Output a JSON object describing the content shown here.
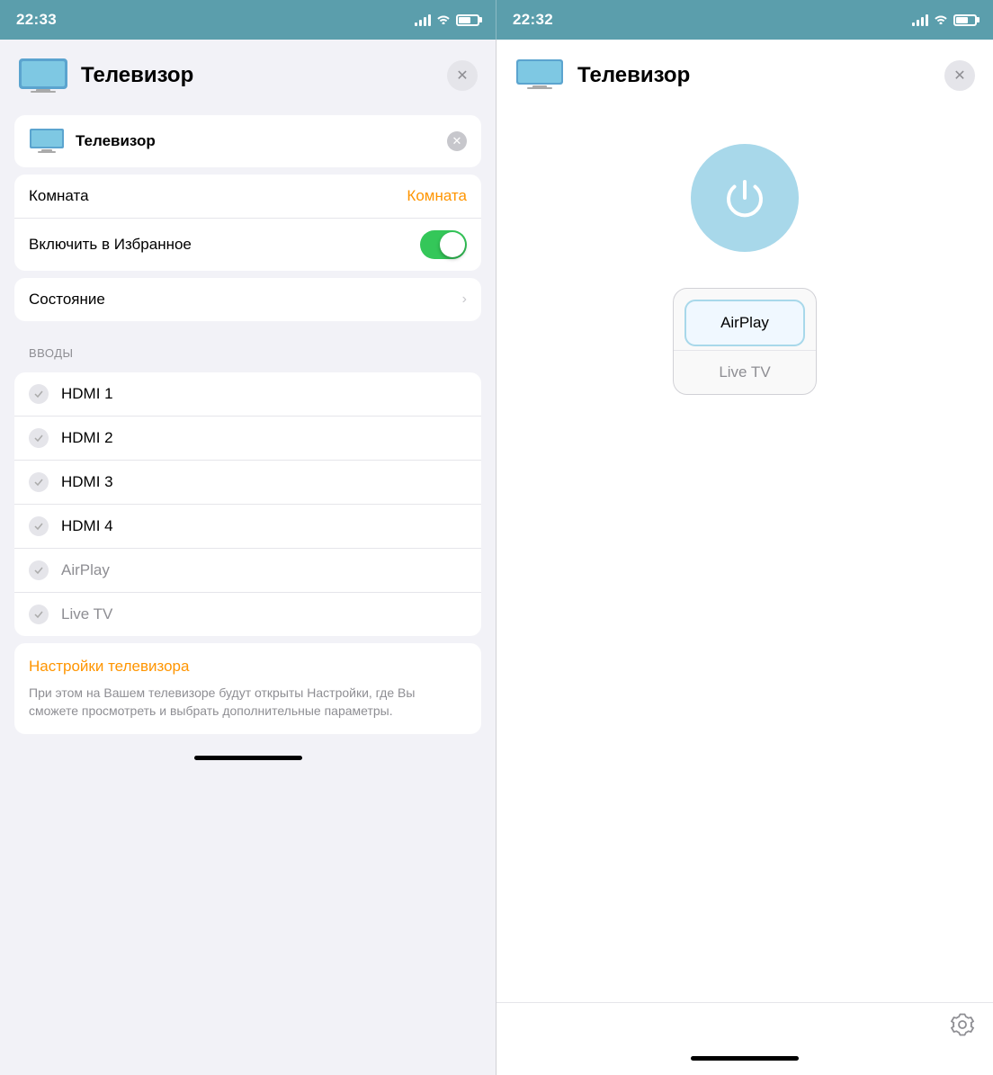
{
  "statusBar": {
    "left": {
      "time": "22:33"
    },
    "right": {
      "time": "22:32"
    }
  },
  "leftPanel": {
    "header": {
      "title": "Телевизор",
      "closeLabel": "✕"
    },
    "deviceCard": {
      "name": "Телевизор",
      "closeLabel": "✕"
    },
    "settings": {
      "roomLabel": "Комната",
      "roomValue": "Комната",
      "favoriteLabel": "Включить в Избранное"
    },
    "statusLabel": "Состояние",
    "inputsSection": "ВВОДЫ",
    "inputs": [
      {
        "label": "HDMI 1",
        "muted": false
      },
      {
        "label": "HDMI 2",
        "muted": false
      },
      {
        "label": "HDMI 3",
        "muted": false
      },
      {
        "label": "HDMI 4",
        "muted": false
      },
      {
        "label": "AirPlay",
        "muted": true
      },
      {
        "label": "Live TV",
        "muted": true
      }
    ],
    "tvSettingsCard": {
      "title": "Настройки телевизора",
      "description": "При этом на Вашем телевизоре будут открыты Настройки, где Вы сможете просмотреть и выбрать дополнительные параметры."
    }
  },
  "rightPanel": {
    "header": {
      "title": "Телевизор",
      "closeLabel": "✕"
    },
    "inputs": [
      {
        "label": "AirPlay",
        "selected": true
      },
      {
        "label": "Live TV",
        "selected": false
      }
    ]
  }
}
